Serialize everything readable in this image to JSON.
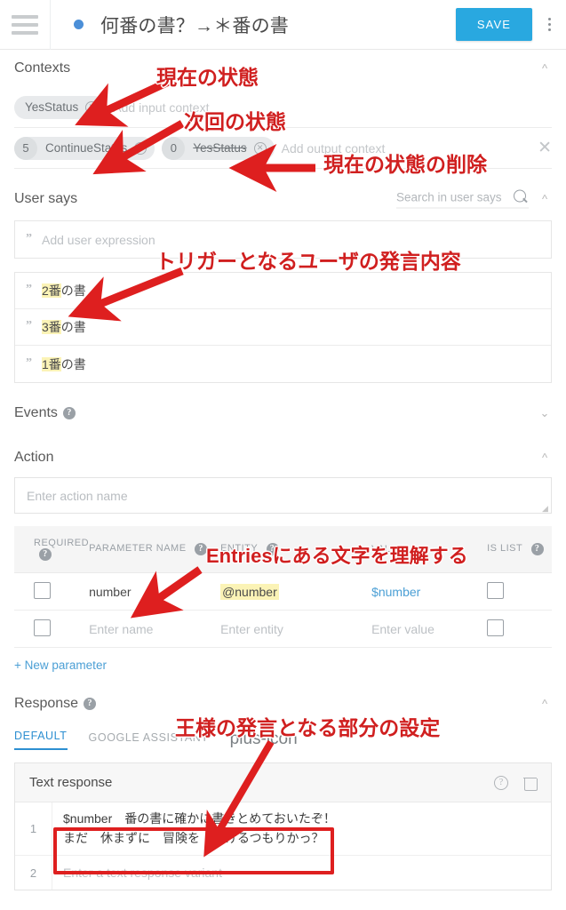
{
  "header": {
    "menu_icon": "hamburger-icon",
    "intent_title": "何番の書？→＊番の書",
    "save_label": "SAVE",
    "more_icon": "kebab-menu-icon",
    "accent_color": "#29a8e0"
  },
  "contexts": {
    "title": "Contexts",
    "collapse_icon": "chevron-up-icon",
    "input": {
      "chips": [
        {
          "label": "YesStatus",
          "remove_icon": "remove-circle-icon"
        }
      ],
      "placeholder": "Add input context"
    },
    "output": {
      "chips": [
        {
          "count": "5",
          "label": "ContinueStatus",
          "remove_icon": "remove-circle-icon",
          "struck": false
        },
        {
          "count": "0",
          "label": "YesStatus",
          "remove_icon": "remove-circle-icon",
          "struck": true
        }
      ],
      "placeholder": "Add output context",
      "clear_icon": "close-icon"
    }
  },
  "user_says": {
    "title": "User says",
    "search_placeholder": "Search in user says",
    "search_value": "",
    "search_icon": "search-icon",
    "collapse_icon": "chevron-up-icon",
    "add_placeholder": "Add user expression",
    "quote_icon": "quote-icon",
    "expressions": [
      {
        "highlight": "2番",
        "rest": "の書"
      },
      {
        "highlight": "3番",
        "rest": "の書"
      },
      {
        "highlight": "1番",
        "rest": "の書"
      }
    ]
  },
  "events": {
    "title": "Events",
    "help_icon": "help-icon",
    "expand_icon": "chevron-down-icon"
  },
  "action": {
    "title": "Action",
    "collapse_icon": "chevron-up-icon",
    "name_placeholder": "Enter action name",
    "name_value": "",
    "table": {
      "columns": [
        "REQUIRED",
        "PARAMETER NAME",
        "ENTITY",
        "VALUE",
        "IS LIST"
      ],
      "column_help": [
        true,
        true,
        true,
        false,
        true
      ],
      "rows": [
        {
          "required_checked": false,
          "name": "number",
          "name_is_placeholder": false,
          "entity": "@number",
          "entity_is_placeholder": false,
          "entity_highlighted": true,
          "value": "$number",
          "value_is_placeholder": false,
          "is_list_checked": false
        },
        {
          "required_checked": false,
          "name": "Enter name",
          "name_is_placeholder": true,
          "entity": "Enter entity",
          "entity_is_placeholder": true,
          "entity_highlighted": false,
          "value": "Enter value",
          "value_is_placeholder": true,
          "is_list_checked": false
        }
      ]
    },
    "new_parameter_label": "New parameter",
    "new_parameter_plus": "+"
  },
  "response": {
    "title": "Response",
    "help_icon": "help-icon",
    "collapse_icon": "chevron-up-icon",
    "tabs": [
      {
        "label": "DEFAULT",
        "active": true
      },
      {
        "label": "GOOGLE ASSISTANT",
        "active": false
      }
    ],
    "add_tab_icon": "plus-icon",
    "card": {
      "title": "Text response",
      "help_icon": "help-icon",
      "delete_icon": "trash-icon",
      "rows": [
        {
          "num": "1",
          "text": "$number　番の書に確かに書きとめておいたぞ！\nまだ　休まずに　冒険を　続けるつもりかっ？",
          "is_placeholder": false
        },
        {
          "num": "2",
          "text": "Enter a text response variant",
          "is_placeholder": true
        }
      ]
    }
  },
  "annotations": {
    "color": "#d01f1f",
    "items": [
      {
        "text": "現在の状態"
      },
      {
        "text": "次回の状態"
      },
      {
        "text": "現在の状態の削除"
      },
      {
        "text": "トリガーとなるユーザの発言内容"
      },
      {
        "text": "Entriesにある文字を理解する"
      },
      {
        "text": "王様の発言となる部分の設定"
      }
    ]
  }
}
